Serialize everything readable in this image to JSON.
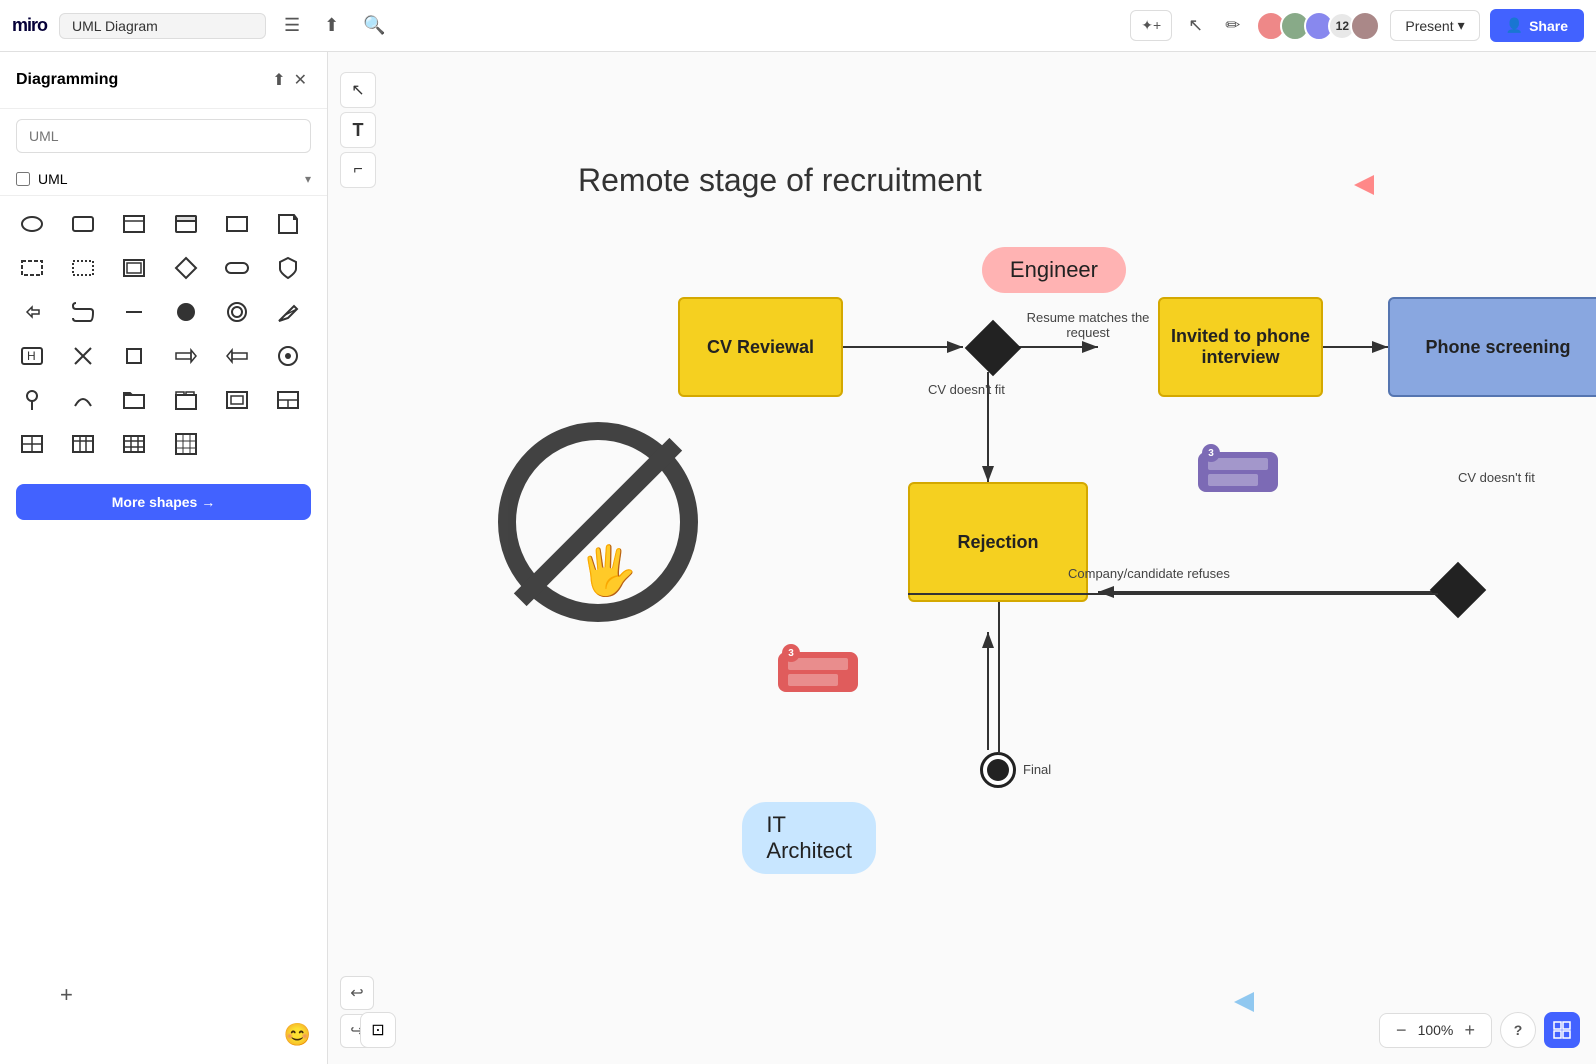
{
  "app": {
    "logo": "miro",
    "diagram_title": "UML Diagram"
  },
  "topbar": {
    "menu_icon": "☰",
    "share_icon": "⬆",
    "search_icon": "🔍",
    "magic_icon": "✦",
    "cursor_icon": "↖",
    "marker_icon": "✏",
    "present_label": "Present",
    "present_chevron": "▾",
    "share_label": "Share",
    "user_count": "12"
  },
  "sidebar": {
    "title": "Diagramming",
    "search_placeholder": "UML",
    "export_icon": "⬆",
    "close_icon": "✕",
    "uml_label": "UML",
    "chevron": "▾",
    "more_shapes_label": "More shapes →",
    "emoji_label": "😊"
  },
  "diagram": {
    "title": "Remote stage of recruitment",
    "engineer_label": "Engineer",
    "itarchitect_label": "IT Architect",
    "cv_review_label": "CV Reviewal",
    "invited_label": "Invited to phone\ninterview",
    "phone_screening_label": "Phone screening",
    "rejection_label": "Rejection",
    "resume_matches_label": "Resume matches\nthe request",
    "cv_doesnt_fit_label1": "CV doesn't fit",
    "cv_doesnt_fit_label2": "CV doesn't fit",
    "company_refuses_label": "Company/candidate refuses",
    "final_label": "Final"
  },
  "zoom": {
    "level": "100%",
    "minus": "−",
    "plus": "+"
  },
  "colors": {
    "yellow_box": "#f5d020",
    "blue_box": "#89a7e0",
    "accent": "#4262ff",
    "engineer_bubble": "#ffb3b3",
    "itarchitect_bubble": "#c8e6ff"
  }
}
